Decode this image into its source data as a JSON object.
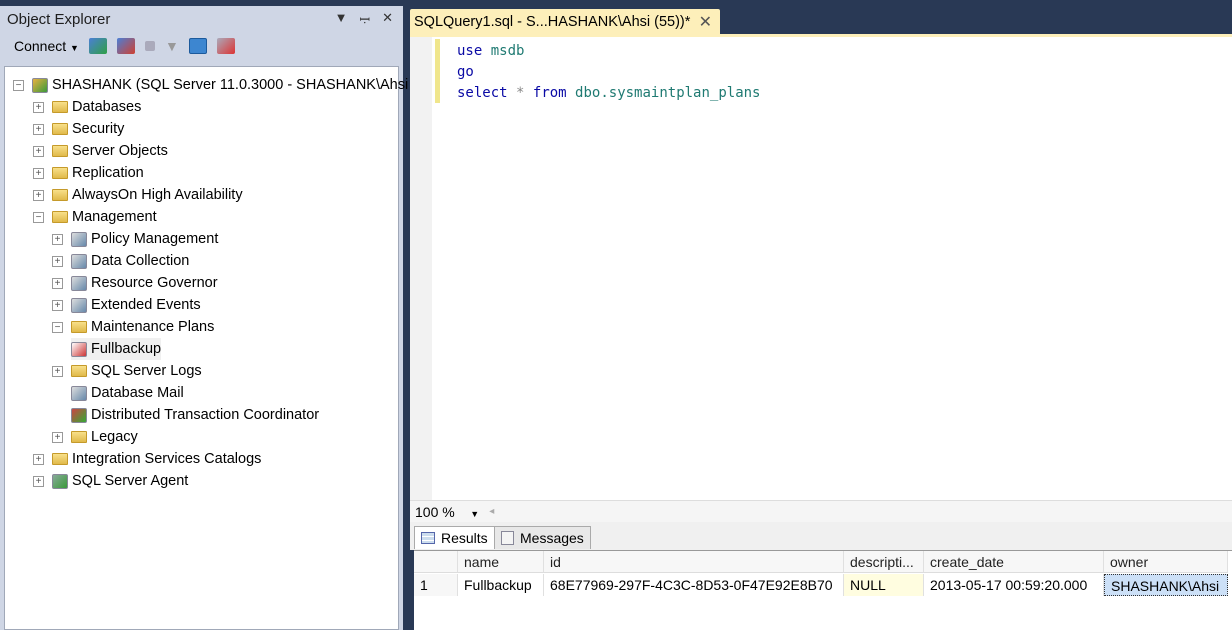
{
  "object_explorer": {
    "title": "Object Explorer",
    "toolbar": {
      "connect_label": "Connect",
      "icons": [
        "connect-icon",
        "disconnect-icon",
        "stop-icon",
        "filter-icon",
        "refresh-icon",
        "activity-monitor-icon"
      ]
    },
    "tree": [
      {
        "label": "SHASHANK (SQL Server 11.0.3000 - SHASHANK\\Ahsi",
        "level": 0,
        "expander": "minus",
        "icon": "server"
      },
      {
        "label": "Databases",
        "level": 1,
        "expander": "plus",
        "icon": "folder"
      },
      {
        "label": "Security",
        "level": 1,
        "expander": "plus",
        "icon": "folder"
      },
      {
        "label": "Server Objects",
        "level": 1,
        "expander": "plus",
        "icon": "folder"
      },
      {
        "label": "Replication",
        "level": 1,
        "expander": "plus",
        "icon": "folder"
      },
      {
        "label": "AlwaysOn High Availability",
        "level": 1,
        "expander": "plus",
        "icon": "folder"
      },
      {
        "label": "Management",
        "level": 1,
        "expander": "minus",
        "icon": "folder"
      },
      {
        "label": "Policy Management",
        "level": 2,
        "expander": "plus",
        "icon": "policy"
      },
      {
        "label": "Data Collection",
        "level": 2,
        "expander": "plus",
        "icon": "data-collection"
      },
      {
        "label": "Resource Governor",
        "level": 2,
        "expander": "plus",
        "icon": "resource-governor"
      },
      {
        "label": "Extended Events",
        "level": 2,
        "expander": "plus",
        "icon": "extended-events"
      },
      {
        "label": "Maintenance Plans",
        "level": 2,
        "expander": "minus",
        "icon": "folder"
      },
      {
        "label": "Fullbackup",
        "level": 3,
        "expander": "none",
        "icon": "maintenance-plan"
      },
      {
        "label": "SQL Server Logs",
        "level": 2,
        "expander": "plus",
        "icon": "folder"
      },
      {
        "label": "Database Mail",
        "level": 2,
        "expander": "none",
        "icon": "database-mail"
      },
      {
        "label": "Distributed Transaction Coordinator",
        "level": 2,
        "expander": "none",
        "icon": "dtc"
      },
      {
        "label": "Legacy",
        "level": 2,
        "expander": "plus",
        "icon": "folder"
      },
      {
        "label": "Integration Services Catalogs",
        "level": 1,
        "expander": "plus",
        "icon": "folder"
      },
      {
        "label": "SQL Server Agent",
        "level": 1,
        "expander": "plus",
        "icon": "agent"
      }
    ]
  },
  "editor": {
    "tab_title": "SQLQuery1.sql - S...HASHANK\\Ahsi (55))*",
    "code": [
      [
        {
          "t": "use",
          "c": "kw"
        },
        {
          "t": " "
        },
        {
          "t": "msdb",
          "c": "id"
        }
      ],
      [
        {
          "t": "go",
          "c": "kw"
        }
      ],
      [
        {
          "t": "select",
          "c": "kw"
        },
        {
          "t": " "
        },
        {
          "t": "*",
          "c": "op"
        },
        {
          "t": " "
        },
        {
          "t": "from",
          "c": "kw"
        },
        {
          "t": " "
        },
        {
          "t": "dbo.sysmaintplan_plans",
          "c": "id"
        }
      ]
    ],
    "zoom": "100 %"
  },
  "results": {
    "tabs": [
      "Results",
      "Messages"
    ],
    "columns": [
      "",
      "name",
      "id",
      "descripti...",
      "create_date",
      "owner"
    ],
    "rows": [
      [
        "1",
        "Fullbackup",
        "68E77969-297F-4C3C-8D53-0F47E92E8B70",
        "NULL",
        "2013-05-17 00:59:20.000",
        "SHASHANK\\Ahsi"
      ]
    ]
  }
}
